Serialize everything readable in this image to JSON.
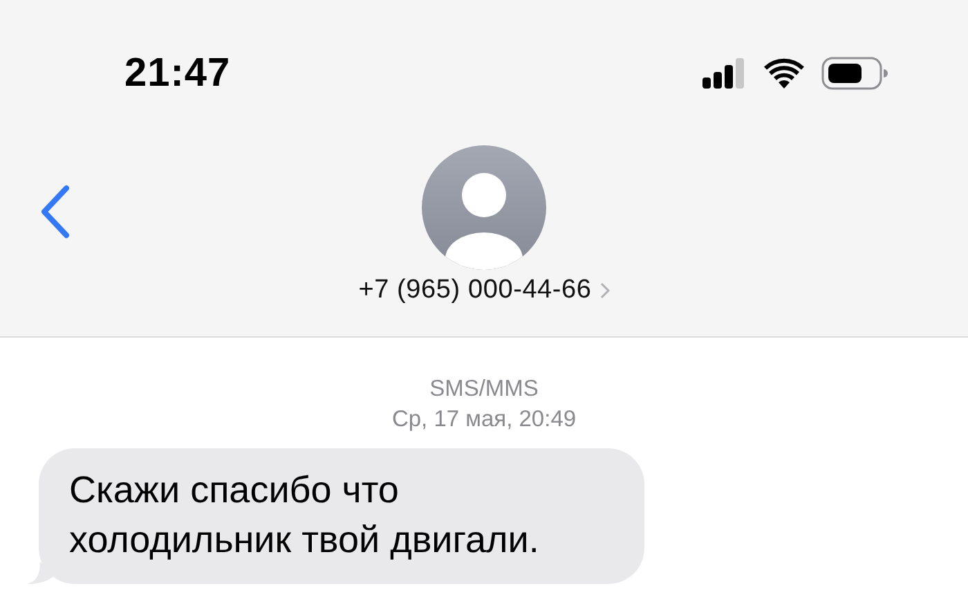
{
  "status_bar": {
    "time": "21:47"
  },
  "header": {
    "contact": "+7 (965) 000-44-66"
  },
  "thread": {
    "service": "SMS/MMS",
    "timestamp": "Ср, 17 мая, 20:49",
    "messages": [
      {
        "text": "Скажи спасибо что холодильник твой двигали.",
        "kind": "incoming"
      }
    ]
  }
}
